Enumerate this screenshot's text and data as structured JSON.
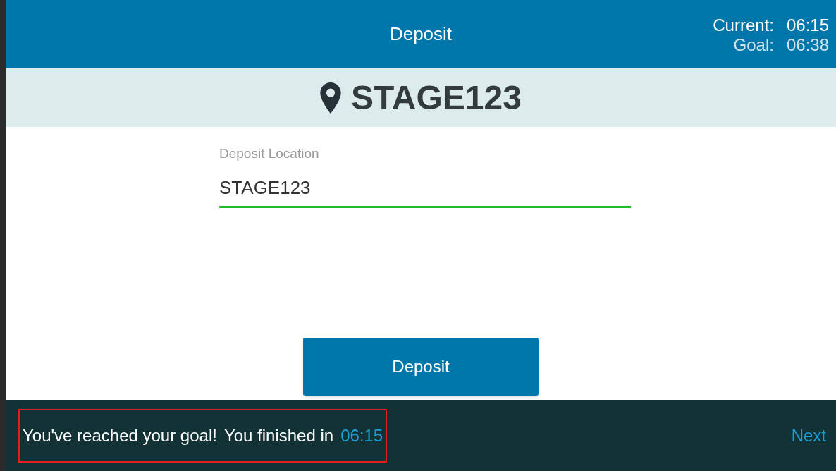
{
  "header": {
    "title": "Deposit",
    "current_label": "Current:",
    "current_time": "06:15",
    "goal_label": "Goal:",
    "goal_time": "06:38"
  },
  "location_banner": {
    "text": "STAGE123"
  },
  "field": {
    "label": "Deposit Location",
    "value": "STAGE123",
    "valid": true
  },
  "button": {
    "label": "Deposit"
  },
  "footer": {
    "message": "You've reached your goal!",
    "finished_label": "You finished in",
    "finished_time": "06:15",
    "highlighted": true,
    "next": "Next"
  }
}
